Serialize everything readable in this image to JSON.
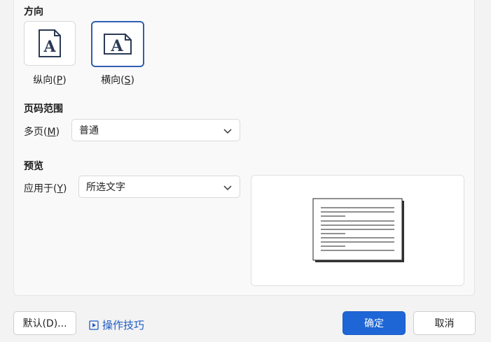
{
  "orientation": {
    "title": "方向",
    "portrait": {
      "label": "纵向",
      "key": "P",
      "icon": "portrait-page-icon"
    },
    "landscape": {
      "label": "横向",
      "key": "S",
      "icon": "landscape-page-icon",
      "selected": true
    }
  },
  "page_range": {
    "title": "页码范围",
    "multi_page_label": "多页",
    "multi_page_key": "M",
    "multi_page_value": "普通"
  },
  "preview": {
    "title": "预览",
    "apply_label": "应用于",
    "apply_key": "Y",
    "apply_value": "所选文字"
  },
  "footer": {
    "default_button": "默认(D)...",
    "tips_link": "操作技巧",
    "ok_button": "确定",
    "cancel_button": "取消"
  },
  "colors": {
    "accent": "#1e66d6",
    "selected_border": "#2f5fb3",
    "link": "#1e5bc6"
  }
}
